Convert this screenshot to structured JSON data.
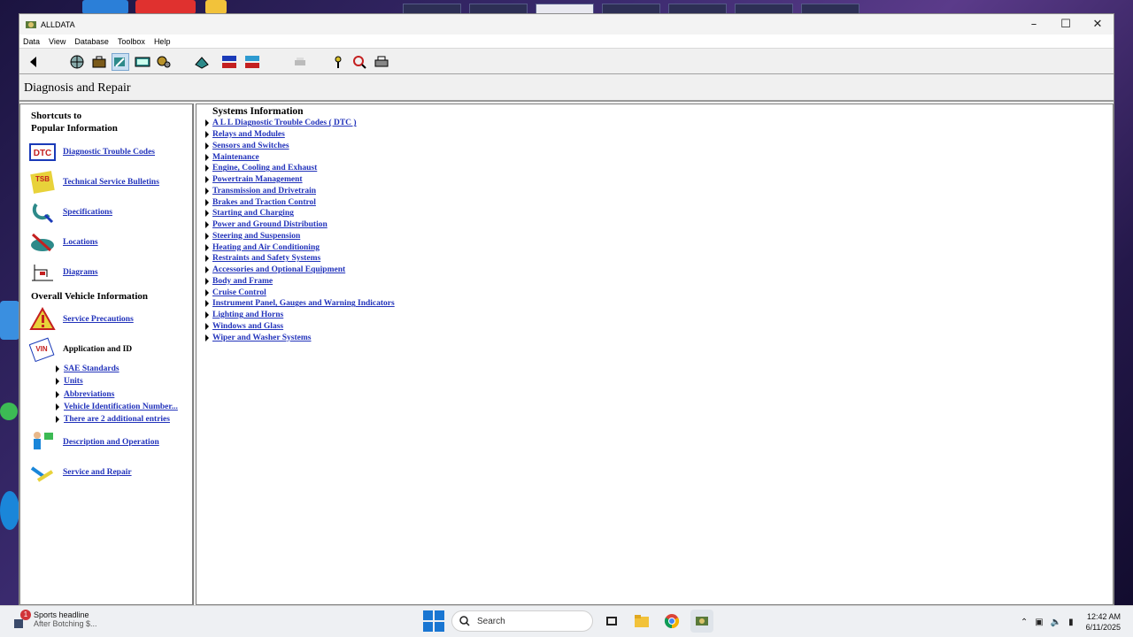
{
  "window": {
    "title": "ALLDATA"
  },
  "menu": [
    "Data",
    "View",
    "Database",
    "Toolbox",
    "Help"
  ],
  "page_title": "Diagnosis and Repair",
  "left_panel": {
    "shortcuts_heading_1": "Shortcuts to",
    "shortcuts_heading_2": "Popular Information",
    "shortcuts": [
      "Diagnostic Trouble Codes",
      "Technical Service Bulletins",
      "Specifications",
      "Locations",
      "Diagrams"
    ],
    "overall_heading": "Overall Vehicle Information",
    "service_precautions": "Service Precautions",
    "application_id": "Application and ID",
    "app_sub": [
      "SAE Standards",
      "Units",
      "Abbreviations",
      "Vehicle Identification Number...",
      "There are 2 additional entries"
    ],
    "description_operation": "Description and Operation",
    "service_repair": "Service and Repair"
  },
  "systems": {
    "heading": "Systems Information",
    "items": [
      "A L L  Diagnostic Trouble Codes ( DTC )",
      "Relays and Modules",
      "Sensors and Switches",
      "Maintenance",
      "Engine, Cooling and Exhaust",
      "Powertrain Management",
      "Transmission and Drivetrain",
      "Brakes and Traction Control",
      "Starting and Charging",
      "Power and Ground Distribution",
      "Steering and Suspension",
      "Heating and Air Conditioning",
      "Restraints and Safety Systems",
      "Accessories and Optional Equipment",
      "Body and Frame",
      "Cruise Control",
      "Instrument Panel, Gauges and Warning Indicators",
      "Lighting and Horns",
      "Windows and Glass",
      "Wiper and Washer Systems"
    ]
  },
  "taskbar": {
    "news_badge": "1",
    "news_title": "Sports headline",
    "news_sub": "After Botching $...",
    "search_placeholder": "Search",
    "time": "12:42 AM",
    "date": "6/11/2025"
  },
  "icons": {
    "dtc": "DTC",
    "tsb": "TSB",
    "vin": "VIN"
  },
  "colors": {
    "link": "#2233bb",
    "accent": "#1976d2"
  }
}
